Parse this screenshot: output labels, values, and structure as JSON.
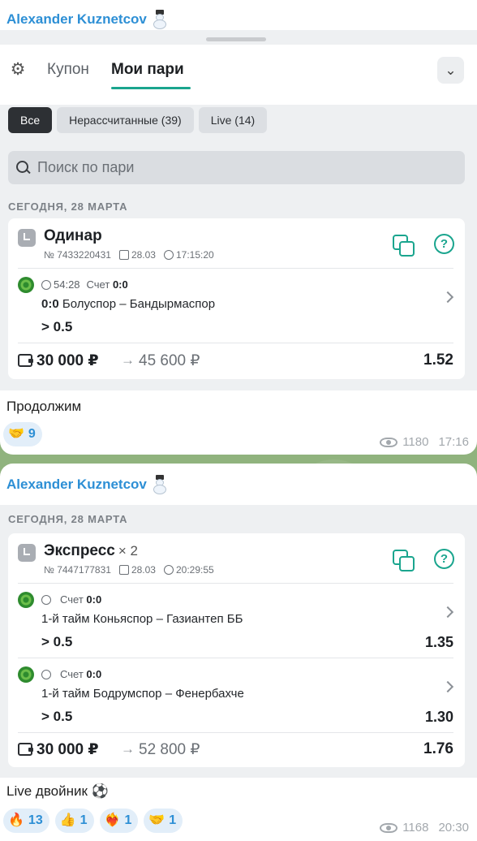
{
  "messages": [
    {
      "sender": "Alexander Kuznetcov",
      "app": {
        "tabs": {
          "coupon": "Купон",
          "my_bets": "Мои пари"
        },
        "filters": [
          "Все",
          "Нерассчитанные (39)",
          "Live (14)"
        ],
        "search_placeholder": "Поиск по пари",
        "date_header": "СЕГОДНЯ, 28 МАРТА",
        "bet": {
          "type": "Одинар",
          "number": "№ 7433220431",
          "date": "28.03",
          "time": "17:15:20",
          "events": [
            {
              "clock": "54:28",
              "score_label": "Счет",
              "score": "0:0",
              "teams_score": "0:0",
              "teams": "Болуспор – Бандырмаспор",
              "pick": "> 0.5"
            }
          ],
          "stake": "30 000 ₽",
          "arrow": "→",
          "payout": "45 600 ₽",
          "total_odds": "1.52"
        }
      },
      "caption": "Продолжим",
      "reactions": [
        {
          "emoji": "🤝",
          "count": "9"
        }
      ],
      "views": "1180",
      "time": "17:16"
    },
    {
      "sender": "Alexander Kuznetcov",
      "app": {
        "date_header": "СЕГОДНЯ, 28 МАРТА",
        "bet": {
          "type": "Экспресс",
          "multiplier": "× 2",
          "number": "№ 7447177831",
          "date": "28.03",
          "time": "20:29:55",
          "events": [
            {
              "score_label": "Счет",
              "score": "0:0",
              "teams": "1-й тайм Коньяспор – Газиантеп ББ",
              "pick": "> 0.5",
              "odds": "1.35"
            },
            {
              "score_label": "Счет",
              "score": "0:0",
              "teams": "1-й тайм Бодрумспор – Фенербахче",
              "pick": "> 0.5",
              "odds": "1.30"
            }
          ],
          "stake": "30 000 ₽",
          "arrow": "→",
          "payout": "52 800 ₽",
          "total_odds": "1.76"
        }
      },
      "caption": "Live двойник ⚽",
      "reactions": [
        {
          "emoji": "🔥",
          "count": "13"
        },
        {
          "emoji": "👍",
          "count": "1"
        },
        {
          "emoji": "❤️‍🔥",
          "count": "1"
        },
        {
          "emoji": "🤝",
          "count": "1"
        }
      ],
      "views": "1168",
      "time": "20:30"
    }
  ],
  "colors": {
    "accent": "#1aa58e",
    "sender": "#2d8fd5"
  }
}
